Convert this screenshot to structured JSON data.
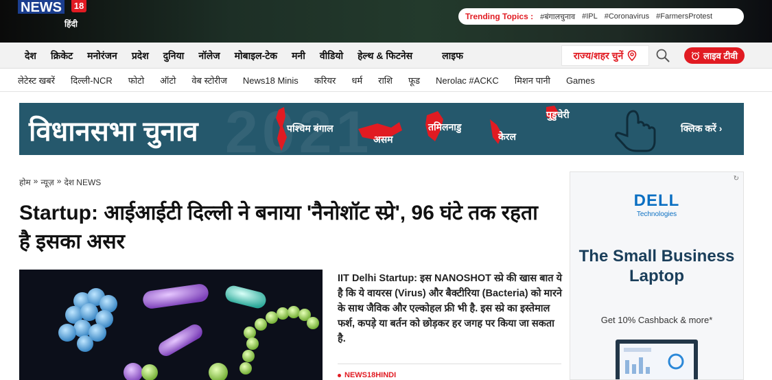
{
  "header": {
    "logo_text": "NEWS",
    "logo_number": "18",
    "logo_hindi": "हिंदी",
    "trending_label": "Trending Topics :",
    "trending_tags": [
      "#बंगालचुनाव",
      "#IPL",
      "#Coronavirus",
      "#FarmersProtest"
    ]
  },
  "main_nav": {
    "items": [
      "देश",
      "क्रिकेट",
      "मनोरंजन",
      "प्रदेश",
      "दुनिया",
      "नॉलेज",
      "मोबाइल-टेक",
      "मनी",
      "वीडियो",
      "हेल्थ & फिटनेस",
      "लाइफ"
    ],
    "state_select": "राज्य/शहर चुनें",
    "live_tv": "लाइव टीवी"
  },
  "sub_nav": {
    "items": [
      "लेटेस्ट खबरें",
      "दिल्ली-NCR",
      "फोटो",
      "ऑटो",
      "वेब स्टोरीज",
      "News18 Minis",
      "करियर",
      "धर्म",
      "राशि",
      "फूड",
      "Nerolac #ACKC",
      "मिशन पानी",
      "Games"
    ]
  },
  "banner": {
    "title": "विधानसभा चुनाव",
    "year": "2021",
    "states": [
      "पश्चिम बंगाल",
      "असम",
      "तमिलनाडु",
      "केरल",
      "पुडुचेरी"
    ],
    "cta": "क्लिक करें ›"
  },
  "article": {
    "breadcrumb": [
      "होम",
      "»",
      "न्यूज़",
      "»",
      "देश NEWS"
    ],
    "headline": "Startup: आईआईटी दिल्ली ने बनाया 'नैनोशॉट स्प्रे', 96 घंटे तक रहता है इसका असर",
    "summary": "IIT Delhi Startup: इस NANOSHOT स्प्रे की खास बात ये है कि ये वायरस (Virus) और बैक्टीरिया (Bacteria) को मारने के साथ जैविक और एल्कोहल फ्री भी है. इस स्प्रे का इस्तेमाल फर्श, कपड़े या बर्तन को छोड़कर हर जगह पर किया जा सकता है.",
    "source": "NEWS18HINDI"
  },
  "ad": {
    "brand": "DELL",
    "brand_sub": "Technologies",
    "headline": "The Small Business Laptop",
    "offer": "Get 10% Cashback & more*"
  },
  "colors": {
    "accent_red": "#e11b22",
    "banner_bg": "#25586c",
    "dell_blue": "#0a6fc2"
  }
}
